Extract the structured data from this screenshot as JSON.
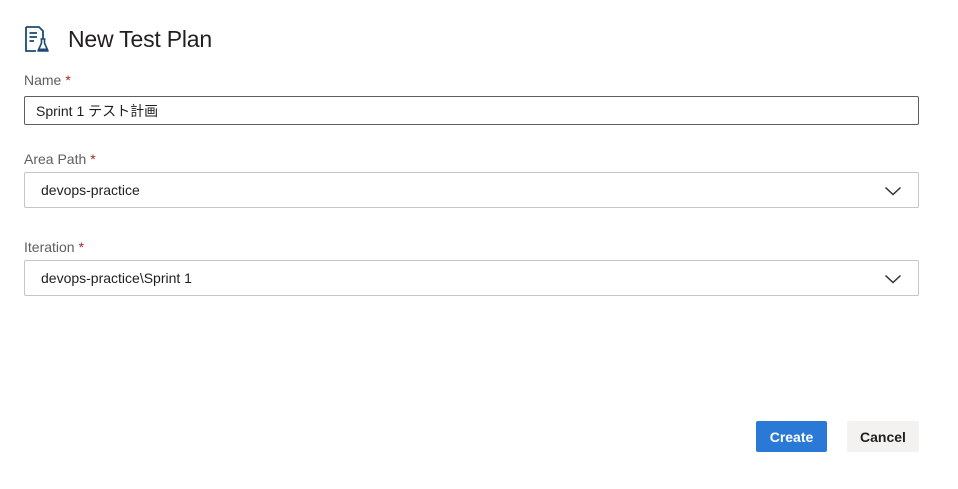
{
  "dialog": {
    "title": "New Test Plan",
    "header_icon": "test-plan-icon"
  },
  "form": {
    "name": {
      "label": "Name",
      "required_marker": "*",
      "value": "Sprint 1 テスト計画"
    },
    "area_path": {
      "label": "Area Path",
      "required_marker": "*",
      "value": "devops-practice",
      "icon": "chevron-down-icon"
    },
    "iteration": {
      "label": "Iteration",
      "required_marker": "*",
      "value": "devops-practice\\Sprint 1",
      "icon": "chevron-down-icon"
    }
  },
  "actions": {
    "create_label": "Create",
    "cancel_label": "Cancel"
  },
  "colors": {
    "primary": "#2b79d6",
    "required": "#a4262c",
    "icon": "#1e4b73"
  }
}
